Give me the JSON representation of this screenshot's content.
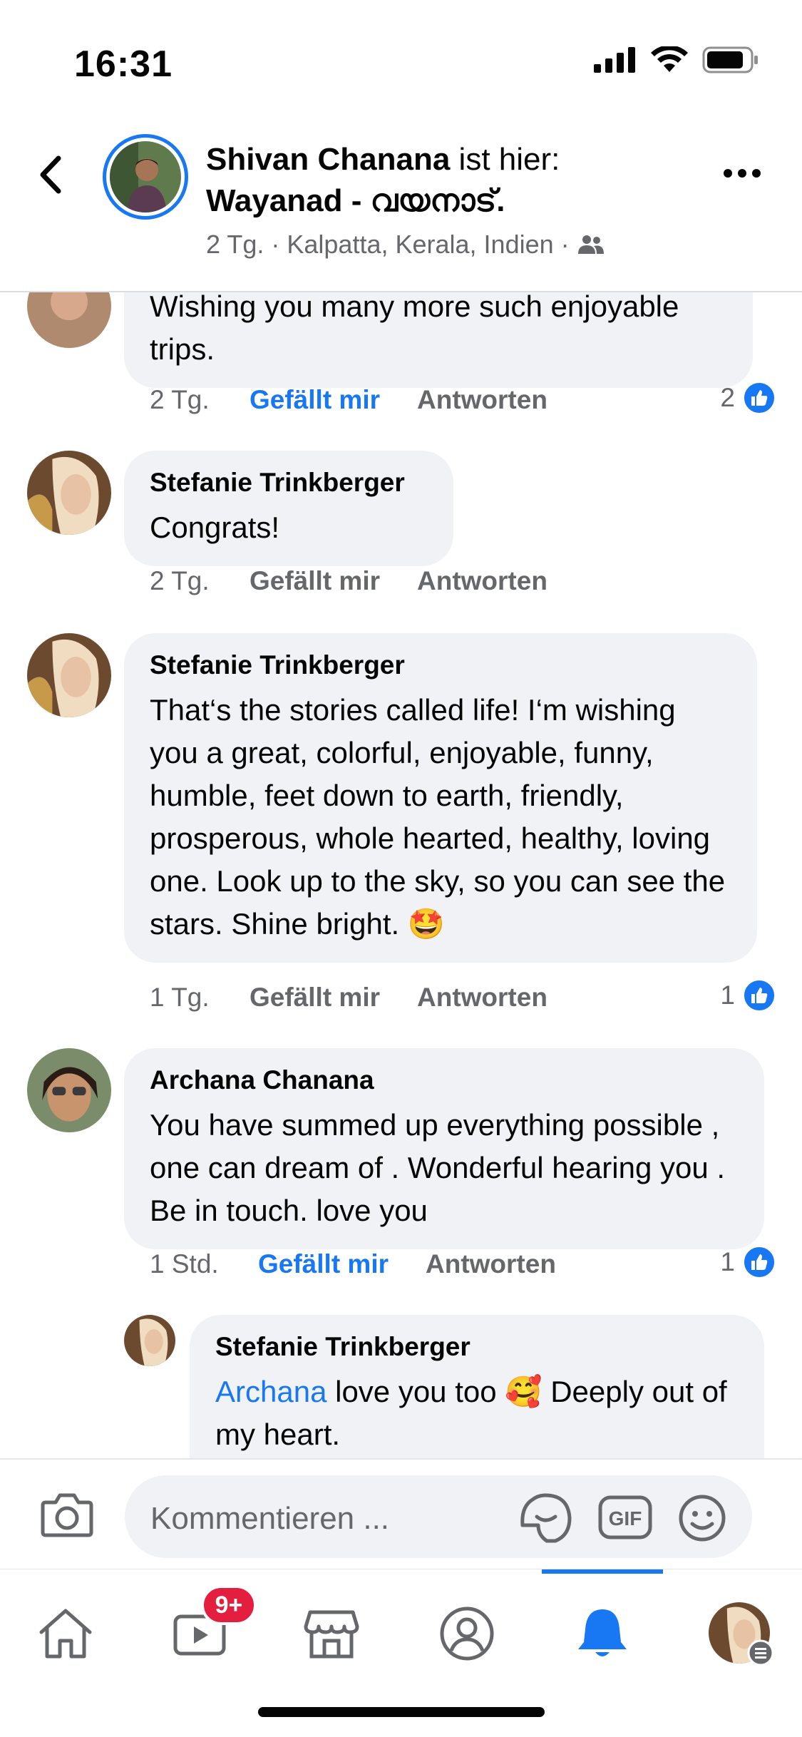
{
  "status_bar": {
    "time": "16:31"
  },
  "header": {
    "author": "Shivan Chanana",
    "verb": " ist hier:",
    "place": "Wayanad - വയനാട്.",
    "meta": "2 Tg. · Kalpatta, Kerala, Indien ·",
    "privacy_icon": "friends-icon"
  },
  "comments": [
    {
      "text": "Wishing you many more such enjoyable trips.",
      "time": "2 Tg.",
      "like_label": "Gefällt mir",
      "reply_label": "Antworten",
      "like_count": "2",
      "liked": true
    },
    {
      "name": "Stefanie Trinkberger",
      "text": "Congrats!",
      "time": "2 Tg.",
      "like_label": "Gefällt mir",
      "reply_label": "Antworten"
    },
    {
      "name": "Stefanie Trinkberger",
      "text": "That‘s the stories called life! I‘m wishing you a great, colorful, enjoyable, funny, humble, feet down to earth, friendly, prosperous, whole hearted, healthy, loving one. Look up to the sky, so you can see the stars. Shine bright. 🤩",
      "time": "1 Tg.",
      "like_label": "Gefällt mir",
      "reply_label": "Antworten",
      "like_count": "1"
    },
    {
      "name": "Archana Chanana",
      "text": "You have summed up everything possible , one can dream of .  Wonderful hearing you . Be in touch. love you",
      "time": "1 Std.",
      "like_label": "Gefällt mir",
      "reply_label": "Antworten",
      "like_count": "1",
      "liked": true
    },
    {
      "name": "Stefanie Trinkberger",
      "mention": "Archana",
      "text": " love you too 🥰 Deeply out of my heart."
    }
  ],
  "composer": {
    "placeholder": "Kommentieren ..."
  },
  "tabbar": {
    "video_badge": "9+"
  },
  "colors": {
    "accent": "#1877f2",
    "bubble": "#f0f2f5",
    "badge": "#e41e3f",
    "meta": "#65676b"
  }
}
